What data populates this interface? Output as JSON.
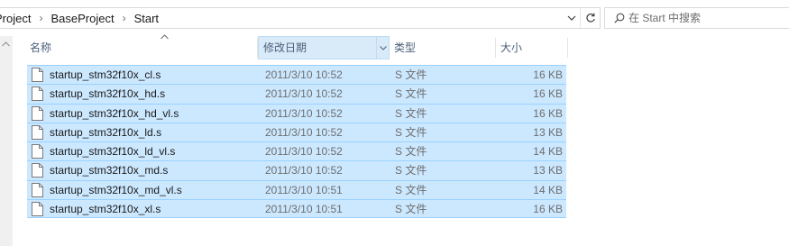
{
  "address_bar": {
    "breadcrumbs": [
      "Project",
      "BaseProject",
      "Start"
    ]
  },
  "search": {
    "placeholder": "搜索 Start",
    "display": "在 Start 中搜索"
  },
  "columns": {
    "name": "名称",
    "date": "修改日期",
    "type": "类型",
    "size": "大小"
  },
  "files": [
    {
      "name": "startup_stm32f10x_cl.s",
      "date": "2011/3/10 10:52",
      "type": "S 文件",
      "size": "16 KB"
    },
    {
      "name": "startup_stm32f10x_hd.s",
      "date": "2011/3/10 10:52",
      "type": "S 文件",
      "size": "16 KB"
    },
    {
      "name": "startup_stm32f10x_hd_vl.s",
      "date": "2011/3/10 10:52",
      "type": "S 文件",
      "size": "16 KB"
    },
    {
      "name": "startup_stm32f10x_ld.s",
      "date": "2011/3/10 10:52",
      "type": "S 文件",
      "size": "13 KB"
    },
    {
      "name": "startup_stm32f10x_ld_vl.s",
      "date": "2011/3/10 10:52",
      "type": "S 文件",
      "size": "14 KB"
    },
    {
      "name": "startup_stm32f10x_md.s",
      "date": "2011/3/10 10:52",
      "type": "S 文件",
      "size": "13 KB"
    },
    {
      "name": "startup_stm32f10x_md_vl.s",
      "date": "2011/3/10 10:51",
      "type": "S 文件",
      "size": "14 KB"
    },
    {
      "name": "startup_stm32f10x_xl.s",
      "date": "2011/3/10 10:51",
      "type": "S 文件",
      "size": "16 KB"
    }
  ],
  "colors": {
    "selection_fill": "#cce8ff",
    "selection_border": "#99d1ff",
    "sorted_column_fill": "#d9ebf9",
    "header_text": "#4c607a",
    "secondary_text": "#6d6d6d"
  },
  "icons": {
    "breadcrumb_separator": "chevron-right-icon",
    "address_dropdown": "chevron-down-icon",
    "refresh": "refresh-icon",
    "search": "search-icon",
    "sort": "sort-ascending-icon",
    "file": "file-icon"
  }
}
